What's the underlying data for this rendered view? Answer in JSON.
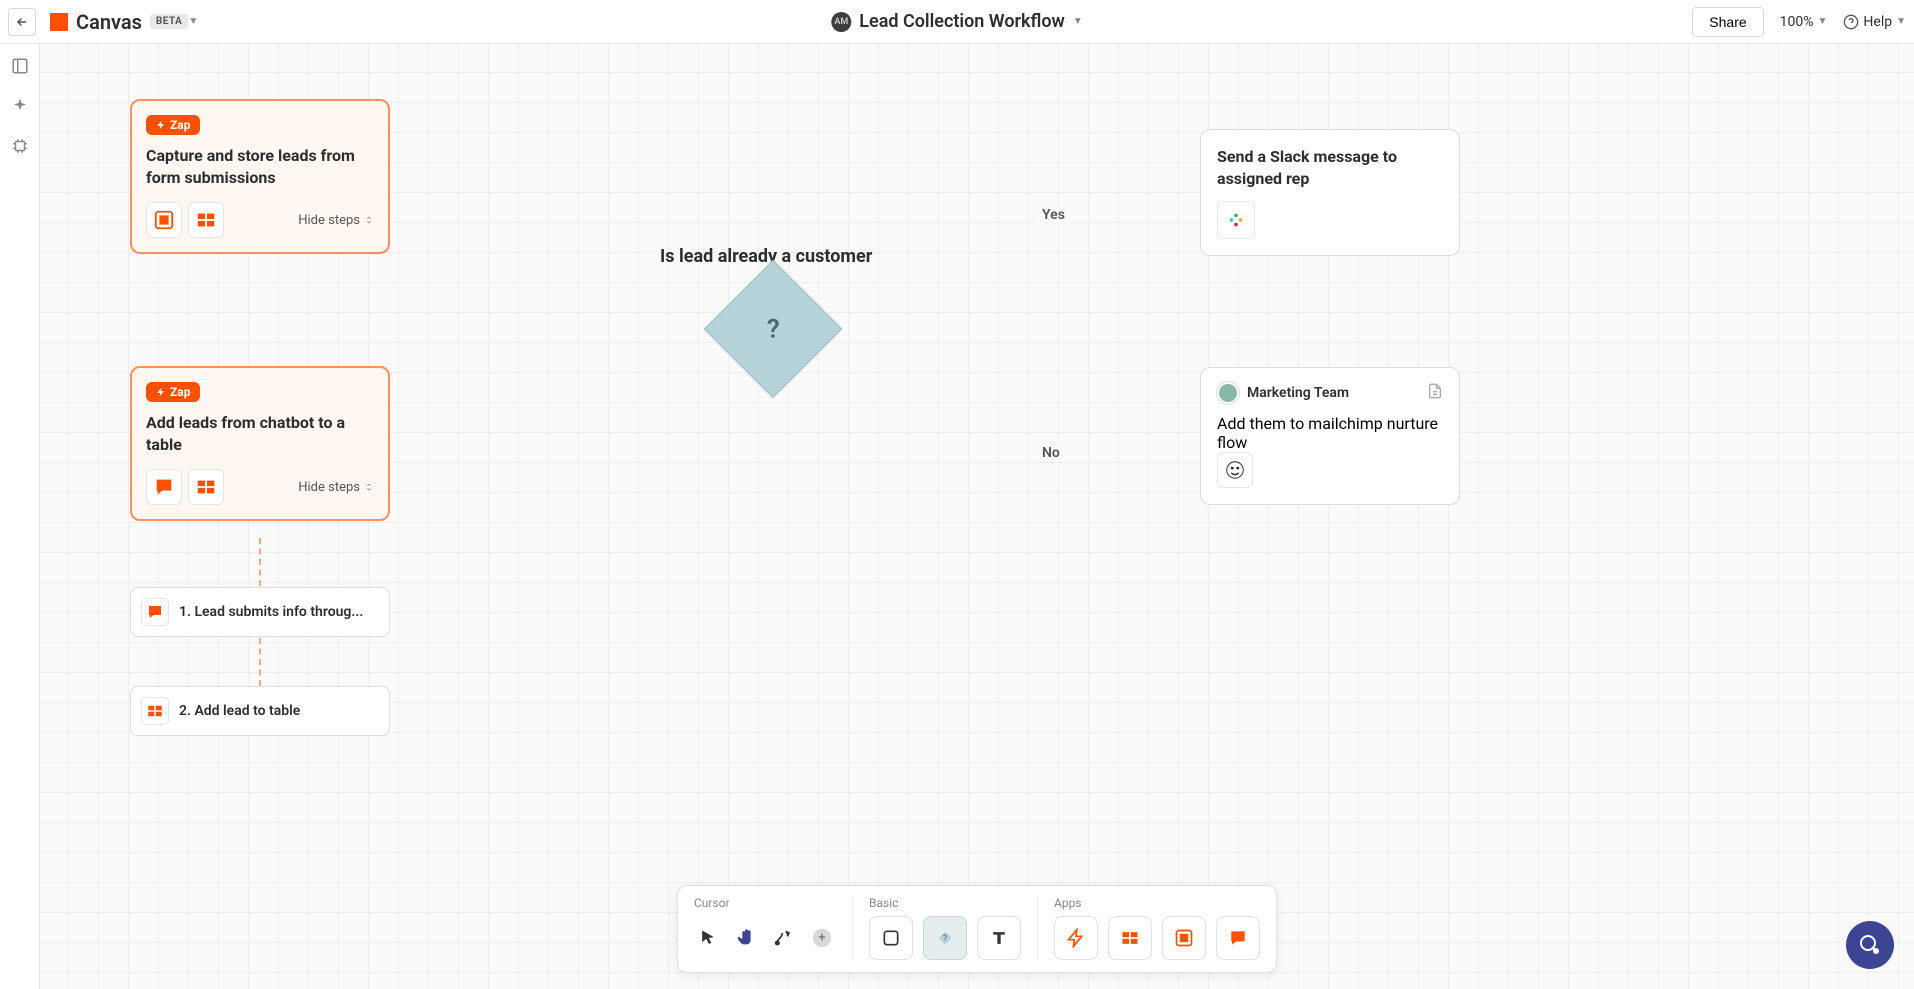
{
  "header": {
    "app_title": "Canvas",
    "badge": "BETA",
    "avatar_text": "AM",
    "document_title": "Lead Collection Workflow",
    "share_label": "Share",
    "zoom_label": "100%",
    "help_label": "Help"
  },
  "cards": {
    "card1": {
      "pill": "Zap",
      "title": "Capture and store leads from form submissions",
      "hide_steps": "Hide steps"
    },
    "card2": {
      "pill": "Zap",
      "title": "Add leads from chatbot to a table",
      "hide_steps": "Hide steps"
    },
    "slack_card": {
      "title": "Send a Slack message to assigned rep"
    },
    "team_card": {
      "team_name": "Marketing Team",
      "title": "Add them to mailchimp nurture flow"
    },
    "step1": {
      "label": "1. Lead submits info throug..."
    },
    "step2": {
      "label": "2. Add lead to table"
    }
  },
  "decision": {
    "title": "Is lead already a customer",
    "symbol": "?",
    "yes_label": "Yes",
    "no_label": "No"
  },
  "toolbar": {
    "cursor_label": "Cursor",
    "basic_label": "Basic",
    "apps_label": "Apps"
  }
}
